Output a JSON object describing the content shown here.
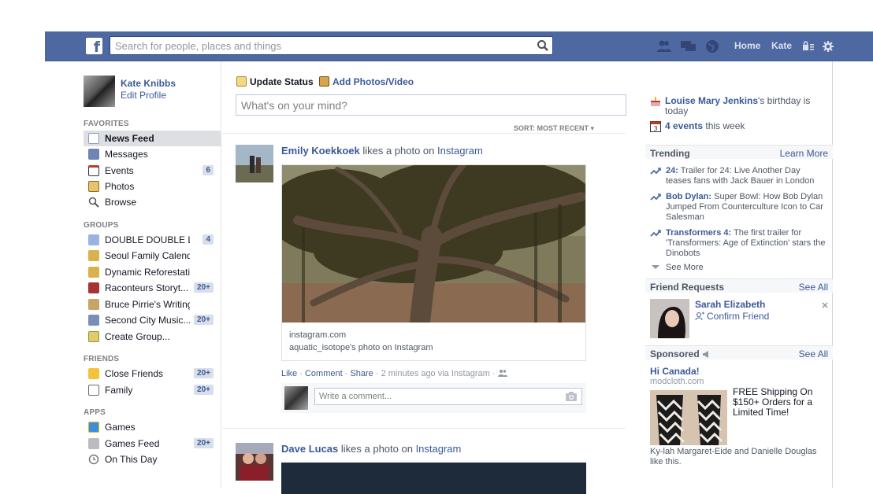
{
  "topbar": {
    "logo": "f",
    "search_placeholder": "Search for people, places and things",
    "home": "Home",
    "user": "Kate"
  },
  "profile": {
    "name": "Kate Knibbs",
    "edit": "Edit Profile"
  },
  "sidebar": {
    "favorites_title": "FAVORITES",
    "favorites": [
      {
        "label": "News Feed",
        "badge": "",
        "active": true
      },
      {
        "label": "Messages",
        "badge": ""
      },
      {
        "label": "Events",
        "badge": "6"
      },
      {
        "label": "Photos",
        "badge": ""
      },
      {
        "label": "Browse",
        "badge": ""
      }
    ],
    "groups_title": "GROUPS",
    "groups": [
      {
        "label": "DOUBLE DOUBLE L...",
        "badge": "4"
      },
      {
        "label": "Seoul Family Calendar",
        "badge": ""
      },
      {
        "label": "Dynamic Reforestation",
        "badge": ""
      },
      {
        "label": "Raconteurs Storyt...",
        "badge": "20+"
      },
      {
        "label": "Bruce Pirrie's Writing Cla...",
        "badge": ""
      },
      {
        "label": "Second City Music...",
        "badge": "20+"
      },
      {
        "label": "Create Group...",
        "badge": ""
      }
    ],
    "friends_title": "FRIENDS",
    "friends": [
      {
        "label": "Close Friends",
        "badge": "20+"
      },
      {
        "label": "Family",
        "badge": "20+"
      }
    ],
    "apps_title": "APPS",
    "apps": [
      {
        "label": "Games",
        "badge": ""
      },
      {
        "label": "Games Feed",
        "badge": "20+"
      },
      {
        "label": "On This Day",
        "badge": ""
      }
    ]
  },
  "composer": {
    "update_status": "Update Status",
    "add_photos": "Add Photos/Video",
    "placeholder": "What's on your mind?"
  },
  "feed": {
    "sort": "SORT: MOST RECENT ▾",
    "stories": [
      {
        "actor": "Emily Koekkoek",
        "verb": " likes a photo on ",
        "app": "Instagram",
        "domain": "instagram.com",
        "title": "aquatic_isotope's photo on Instagram",
        "like": "Like",
        "comment": "Comment",
        "share": "Share",
        "time": "2 minutes ago via Instagram",
        "comment_placeholder": "Write a comment..."
      },
      {
        "actor": "Dave Lucas",
        "verb": " likes a photo on ",
        "app": "Instagram"
      }
    ]
  },
  "right": {
    "birthday_name": "Louise Mary Jenkins",
    "birthday_rest": "'s birthday is today",
    "events_count": "4 events",
    "events_rest": " this week",
    "trending_title": "Trending",
    "trending_more": "Learn More",
    "trending": [
      {
        "topic": "24:",
        "text": " Trailer for 24: Live Another Day teases fans with Jack Bauer in London"
      },
      {
        "topic": "Bob Dylan:",
        "text": " Super Bowl: How Bob Dylan Jumped From Counterculture Icon to Car Salesman"
      },
      {
        "topic": "Transformers 4:",
        "text": " The first trailer for 'Transformers: Age of Extinction' stars the Dinobots"
      }
    ],
    "see_more": "See More",
    "requests_title": "Friend Requests",
    "requests_all": "See All",
    "request_name": "Sarah Elizabeth",
    "confirm": "Confirm Friend",
    "sponsored_title": "Sponsored",
    "sponsored_all": "See All",
    "ad_title": "Hi Canada!",
    "ad_domain": "modcloth.com",
    "ad_text": "FREE Shipping On $150+ Orders for a Limited Time!",
    "ad_social": "Ky-lah Margaret-Eide and Danielle Douglas like this."
  },
  "colors": {
    "brand": "#4e69a2",
    "link": "#3b5998"
  }
}
